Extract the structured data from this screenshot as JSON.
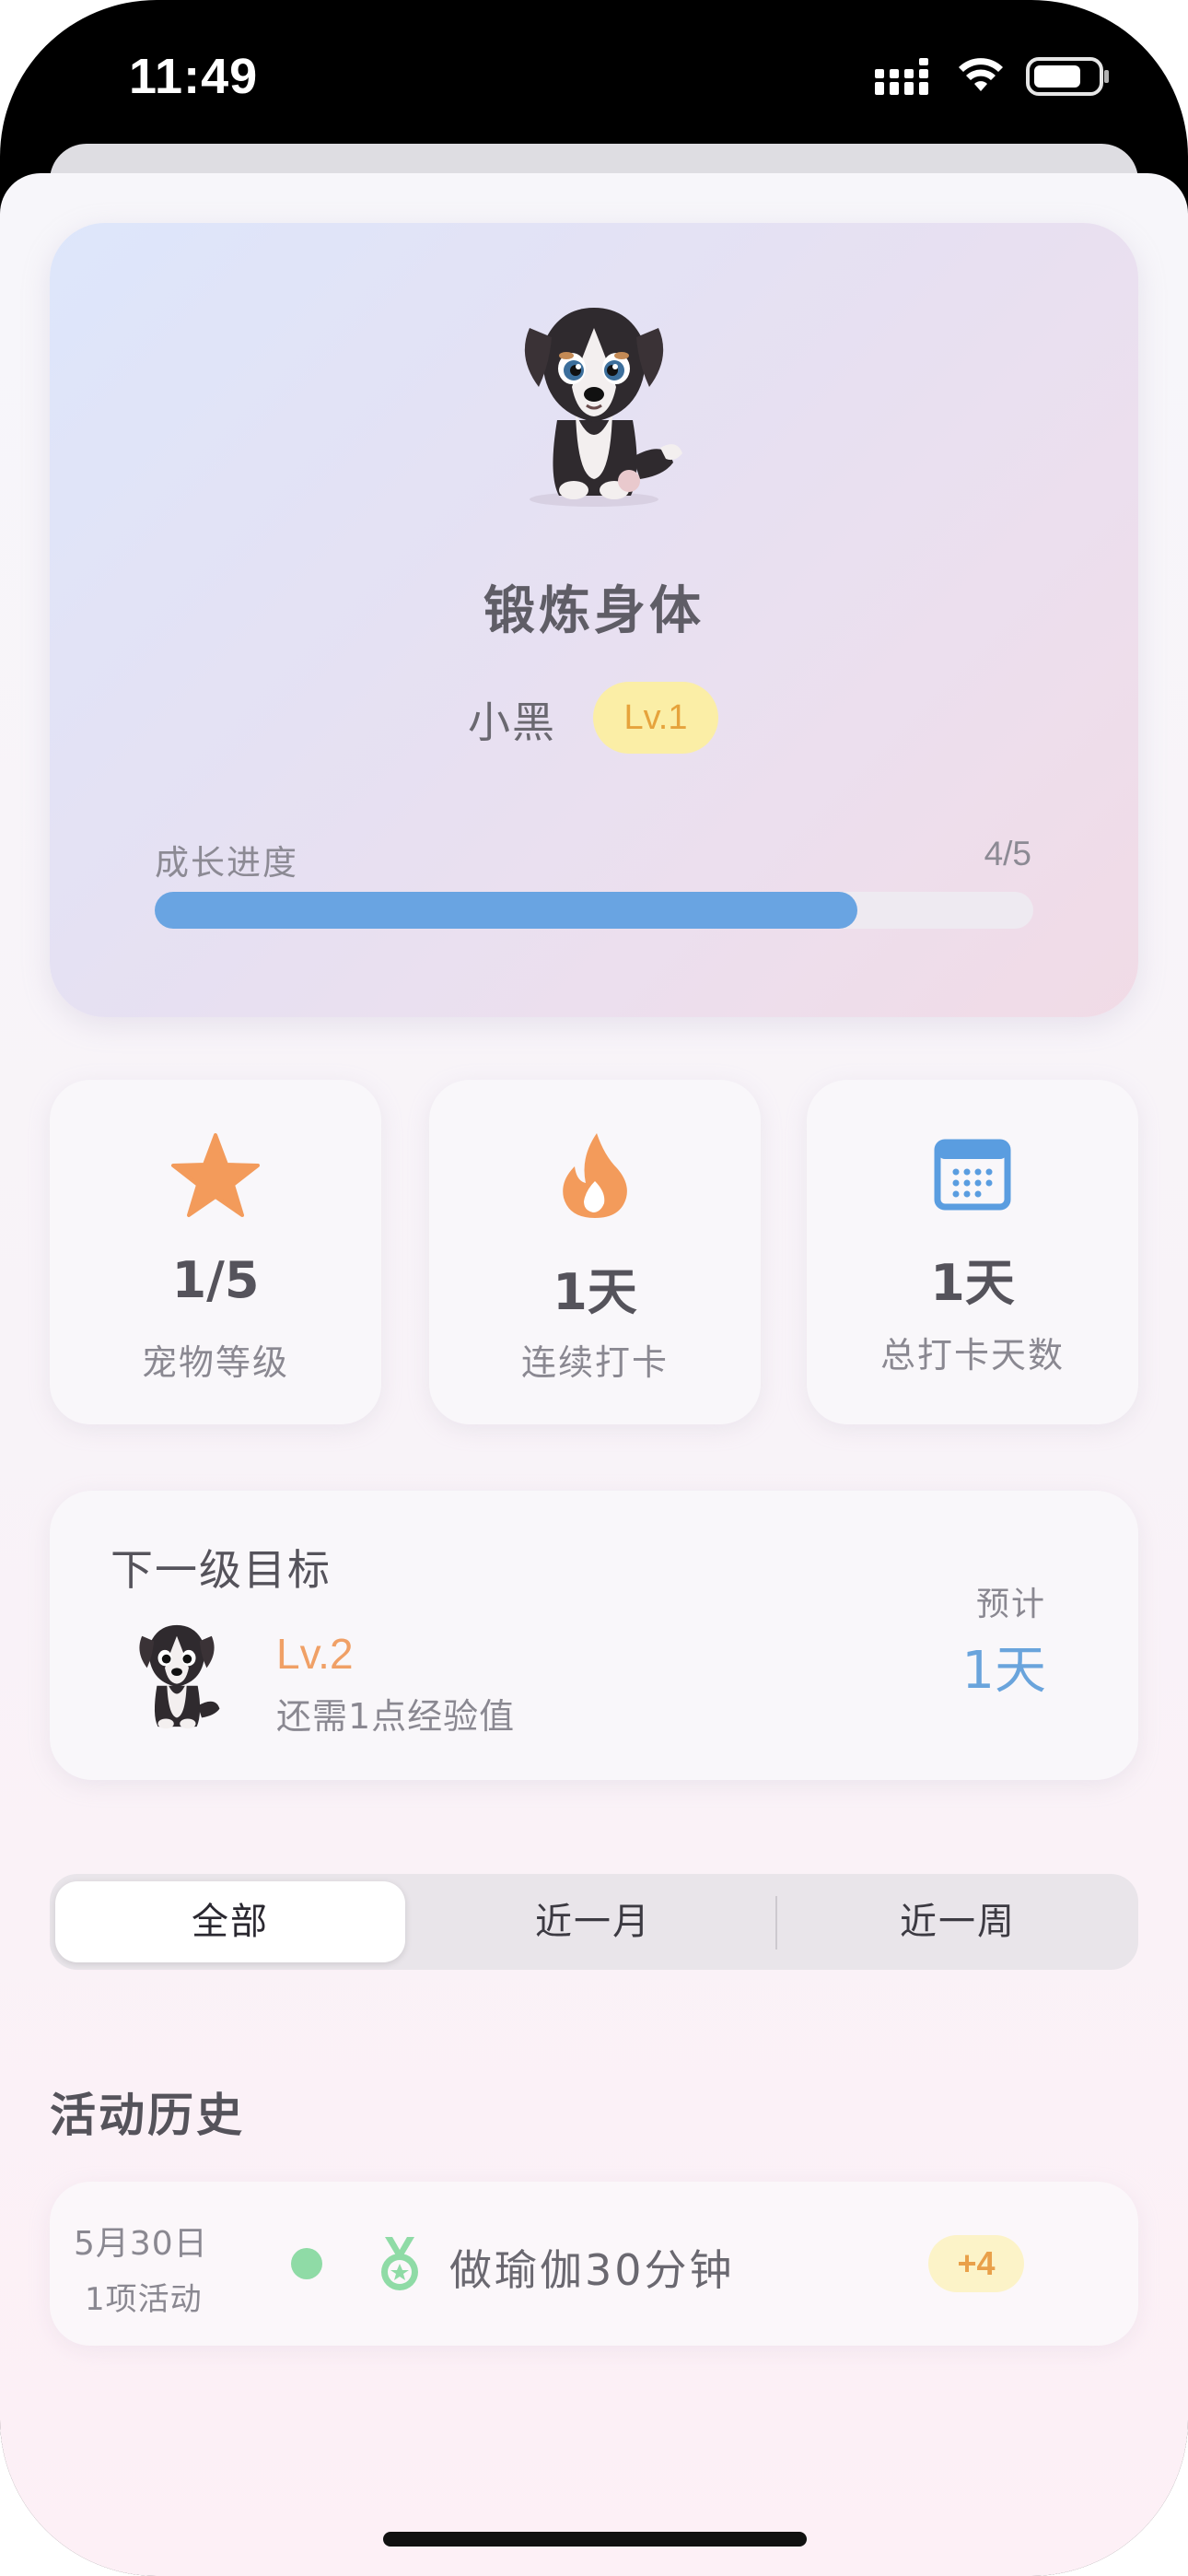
{
  "status_bar": {
    "time": "11:49"
  },
  "hero": {
    "title": "锻炼身体",
    "pet_name": "小黑",
    "level_badge": "Lv.1",
    "progress_label": "成长进度",
    "progress_text": "4/5",
    "progress_fraction": 0.8
  },
  "stats": [
    {
      "icon": "star-icon",
      "value": "1/5",
      "label": "宠物等级",
      "color": "#f39b5b"
    },
    {
      "icon": "flame-icon",
      "value": "1天",
      "label": "连续打卡",
      "color": "#f39b5b"
    },
    {
      "icon": "calendar-icon",
      "value": "1天",
      "label": "总打卡天数",
      "color": "#5a9de0"
    }
  ],
  "goal": {
    "title": "下一级目标",
    "level": "Lv.2",
    "description": "还需1点经验值",
    "estimate_label": "预计",
    "estimate_value": "1天"
  },
  "filter_tabs": [
    "全部",
    "近一月",
    "近一周"
  ],
  "history": {
    "title": "活动历史",
    "items": [
      {
        "date": "5月30日",
        "count": "1项活动",
        "activity": "做瑜伽30分钟",
        "points": "+4"
      }
    ]
  }
}
